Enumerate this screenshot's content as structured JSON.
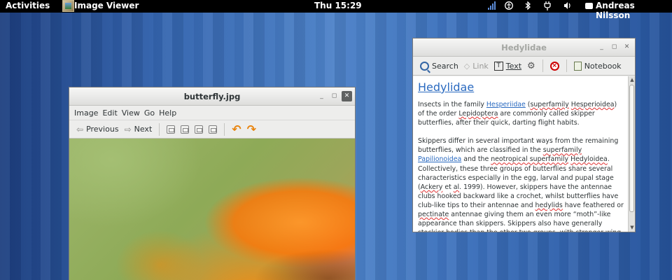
{
  "topbar": {
    "activities": "Activities",
    "app_name": "Image Viewer",
    "clock": "Thu 15:29",
    "user": "Andreas Nilsson",
    "status_icons": [
      "signal-icon",
      "accessibility-icon",
      "bluetooth-icon",
      "power-icon",
      "volume-icon"
    ]
  },
  "viewer": {
    "title": "butterfly.jpg",
    "menu": [
      "Image",
      "Edit",
      "View",
      "Go",
      "Help"
    ],
    "toolbar": {
      "previous": "Previous",
      "next": "Next"
    }
  },
  "help": {
    "title": "Hedylidae",
    "toolbar": {
      "search": "Search",
      "link": "Link",
      "text": "Text",
      "notebook": "Notebook"
    },
    "heading": "Hedylidae",
    "p1": {
      "t1": "Insects in the family ",
      "link1": "Hesperiidae",
      "t2": " (",
      "w1": "superfamily",
      "t3": " ",
      "w2": "Hesperioidea",
      "t4": ") of the order ",
      "w3": "Lepidoptera",
      "t5": " are commonly called skipper butterflies, after their quick, darting flight habits."
    },
    "p2": {
      "t1": "Skippers differ in several important ways from the remaining butterflies, which are classified in the ",
      "w1": "superfamily",
      "t2": " ",
      "link1": "Papilionoidea",
      "t3": " and the ",
      "w2": "neotropical superfamily",
      "t4": " ",
      "w3": "Hedyloidea",
      "t5": ". Collectively, these three groups of butterflies share several characteristics especially in the egg, larval and pupal stage (",
      "w4": "Ackery",
      "t6": " et ",
      "w5": "al",
      "t7": ". 1999). However, skippers have the antennae clubs hooked backward like a crochet, whilst butterflies have club-like tips to their antennae and ",
      "w6": "hedylids",
      "t8": " have feathered or ",
      "w7": "pectinate",
      "t9": " antennae giving them an even more “moth”-like appearance than skippers. Skippers also have generally stockier bodies than the other two groups, with stronger wing muscles. Hesperioidea is very likely the sister"
    }
  }
}
